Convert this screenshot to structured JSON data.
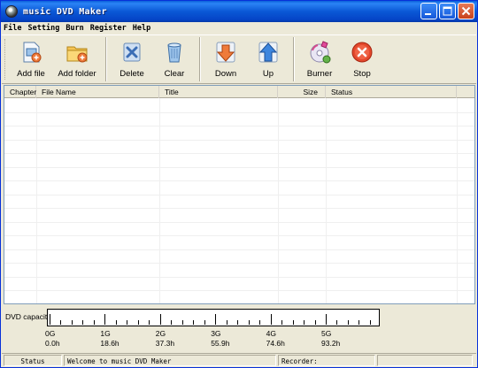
{
  "window": {
    "title": "music DVD Maker"
  },
  "menu": [
    "File",
    "Setting",
    "Burn",
    "Register",
    "Help"
  ],
  "toolbar": {
    "add_file": "Add file",
    "add_folder": "Add folder",
    "delete": "Delete",
    "clear": "Clear",
    "down": "Down",
    "up": "Up",
    "burner": "Burner",
    "stop": "Stop"
  },
  "table": {
    "columns": [
      "Chapter",
      "File Name",
      "Title",
      "Size",
      "Status"
    ],
    "rows": []
  },
  "capacity": {
    "label": "DVD capacity:",
    "marks": [
      {
        "size": "0G",
        "time": "0.0h"
      },
      {
        "size": "1G",
        "time": "18.6h"
      },
      {
        "size": "2G",
        "time": "37.3h"
      },
      {
        "size": "3G",
        "time": "55.9h"
      },
      {
        "size": "4G",
        "time": "74.6h"
      },
      {
        "size": "5G",
        "time": "93.2h"
      }
    ],
    "used_fraction": 0
  },
  "statusbar": {
    "label": "Status",
    "message": "Welcome to music DVD Maker",
    "recorder_label": "Recorder:",
    "recorder_value": ""
  },
  "colors": {
    "titlebar": "#0a58d6",
    "window_bg": "#ece9d8",
    "grid_line": "#efefef"
  },
  "icons": {
    "add_file": "add-file-icon",
    "add_folder": "add-folder-icon",
    "delete": "delete-icon",
    "clear": "clear-icon",
    "down": "down-arrow-icon",
    "up": "up-arrow-icon",
    "burner": "burner-icon",
    "stop": "stop-icon"
  }
}
